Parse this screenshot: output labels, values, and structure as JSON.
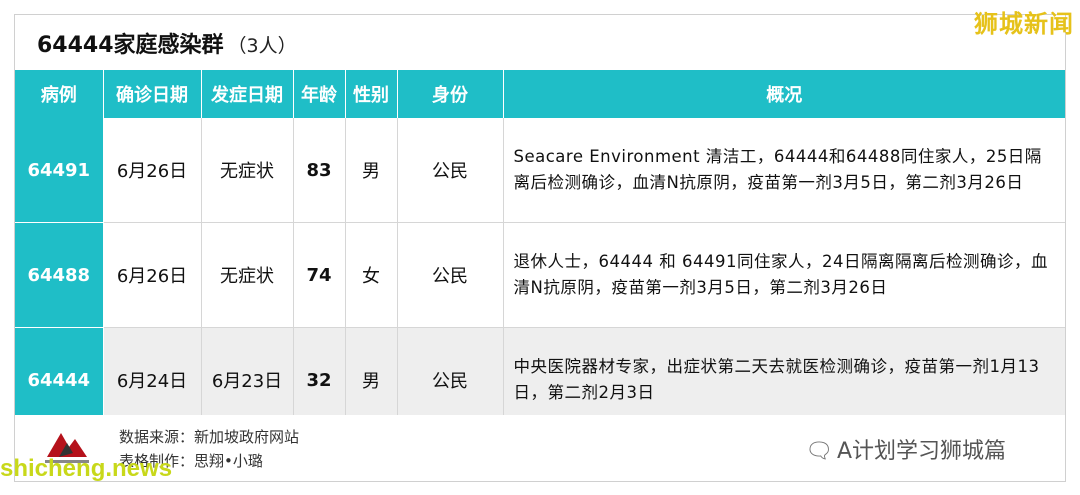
{
  "header": {
    "title": "64444家庭感染群",
    "count": "（3人）",
    "corner_tag": "狮城新闻"
  },
  "table": {
    "columns": [
      "病例",
      "确诊日期",
      "发症日期",
      "年龄",
      "性别",
      "身份",
      "概况"
    ],
    "rows": [
      {
        "id": "64491",
        "confirmed": "6月26日",
        "onset": "无症状",
        "age": "83",
        "sex": "男",
        "status": "公民",
        "summary": "Seacare Environment 清洁工，64444和64488同住家人，25日隔离后检测确诊，血清N抗原阴，疫苗第一剂3月5日，第二剂3月26日"
      },
      {
        "id": "64488",
        "confirmed": "6月26日",
        "onset": "无症状",
        "age": "74",
        "sex": "女",
        "status": "公民",
        "summary": "退休人士，64444 和 64491同住家人，24日隔离隔离后检测确诊，血清N抗原阴，疫苗第一剂3月5日，第二剂3月26日"
      },
      {
        "id": "64444",
        "confirmed": "6月24日",
        "onset": "6月23日",
        "age": "32",
        "sex": "男",
        "status": "公民",
        "summary": "中央医院器材专家，出症状第二天去就医检测确诊，疫苗第一剂1月13日，第二剂2月3日"
      }
    ]
  },
  "footer": {
    "source": "数据来源：新加坡政府网站",
    "made_by": "表格制作：思翔•小璐",
    "wechat_label": "A计划学习狮城篇",
    "site_mark": "shicheng.news"
  },
  "colors": {
    "header_bg": "#1fbec7",
    "alt_row_bg": "#eeeeee",
    "corner_tag": "#e6c21a"
  },
  "icons": {
    "logo": "logo-icon",
    "wechat": "wechat-icon"
  }
}
